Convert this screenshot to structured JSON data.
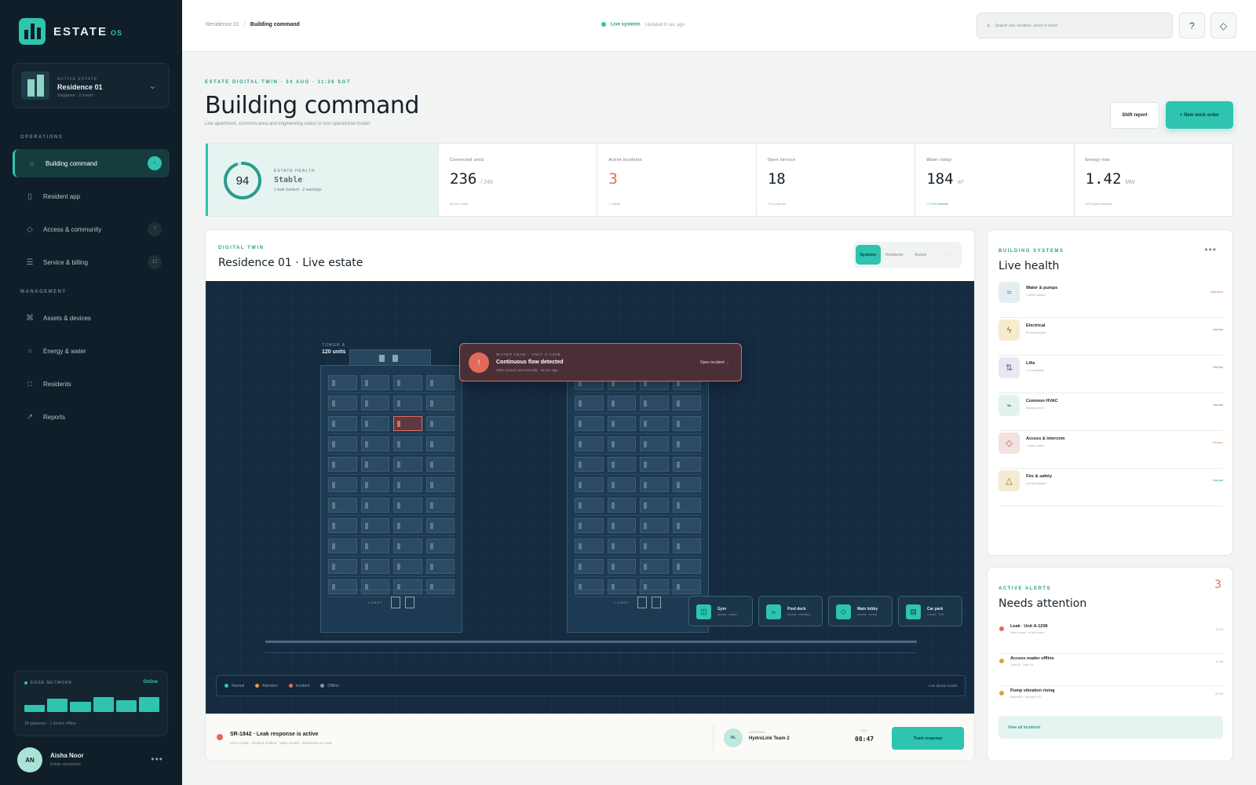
{
  "brand": {
    "name": "ESTATE",
    "suffix": "OS"
  },
  "estate": {
    "kicker": "ACTIVE ESTATE",
    "name": "Residence 01",
    "sub": "Singapore · 2 towers"
  },
  "nav": {
    "operations_heading": "OPERATIONS",
    "management_heading": "MANAGEMENT",
    "items": [
      {
        "label": "Building command",
        "icon": "home-icon",
        "badge": "›"
      },
      {
        "label": "Resident app",
        "icon": "phone-icon",
        "badge": ""
      },
      {
        "label": "Access & community",
        "icon": "diamond-icon",
        "badge": "7"
      },
      {
        "label": "Service & billing",
        "icon": "list-icon",
        "badge": "12"
      },
      {
        "label": "Assets & devices",
        "icon": "command-icon",
        "badge": ""
      },
      {
        "label": "Energy & water",
        "icon": "circle-icon",
        "badge": ""
      },
      {
        "label": "Residents",
        "icon": "square-icon",
        "badge": ""
      },
      {
        "label": "Reports",
        "icon": "trend-icon",
        "badge": ""
      }
    ]
  },
  "edge": {
    "title": "EDGE NETWORK",
    "status": "Online",
    "bars": [
      0.4,
      0.75,
      0.6,
      0.85,
      0.7,
      0.85
    ],
    "foot": "18 gateways · 1 device offline"
  },
  "user": {
    "initials": "AN",
    "name": "Aisha Noor",
    "role": "Estate operations"
  },
  "topbar": {
    "crumb_parent": "Residence 01",
    "crumb_current": "Building command",
    "live_label": "Live systems",
    "live_updated": "Updated 8 sec ago",
    "search_placeholder": "Search unit, resident, asset or ticket",
    "help_glyph": "?"
  },
  "header": {
    "kicker": "ESTATE DIGITAL TWIN · 24 AUG · 11:26 SGT",
    "title": "Building command",
    "subtitle": "Live apartment, common-area and engineering status in one operational model.",
    "shift_report": "Shift report",
    "new_work_order": "+ New work order"
  },
  "kpis": {
    "health": {
      "score": "94",
      "score_fraction": 0.94,
      "kicker": "ESTATE HEALTH",
      "state": "Stable",
      "sub": "1 leak incident · 2 warnings"
    },
    "items": [
      {
        "label": "Connected units",
        "value": "236",
        "unit": "/ 240",
        "foot": "98.3% online",
        "alert": false,
        "good": false
      },
      {
        "label": "Active incidents",
        "value": "3",
        "unit": "",
        "foot": "1 critical",
        "alert": true,
        "good": false
      },
      {
        "label": "Open service",
        "value": "18",
        "unit": "",
        "foot": "7 in progress",
        "alert": false,
        "good": false
      },
      {
        "label": "Water today",
        "value": "184",
        "unit": "m³",
        "foot": "↓ 4.2% baseline",
        "alert": false,
        "good": true
      },
      {
        "label": "Energy now",
        "value": "1.42",
        "unit": "MW",
        "foot": "62% peak capacity",
        "alert": false,
        "good": false
      }
    ]
  },
  "twin": {
    "kicker": "DIGITAL TWIN",
    "title": "Residence 01  · Live estate",
    "segments": [
      "Systems",
      "Residents",
      "Assets",
      "···"
    ],
    "tower_a": {
      "kicker": "TOWER A",
      "units": "120 units",
      "lobby": "LOBBY"
    },
    "tower_b": {
      "lobby": "LOBBY"
    },
    "alert": {
      "kicker": "WATER LEAK · UNIT A-1208",
      "title": "Continuous flow detected",
      "sub": "Valve closed automatically · 48 sec ago",
      "link": "Open incident →",
      "glyph": "!"
    },
    "amenities": [
      {
        "name": "Gym",
        "sub": "Normal · closed",
        "icon": "gym-icon",
        "glyph": "◫"
      },
      {
        "name": "Pool deck",
        "sub": "Normal · chemistry",
        "icon": "wave-icon",
        "glyph": "≈"
      },
      {
        "name": "Main lobby",
        "sub": "Access · normal",
        "icon": "diamond-icon",
        "glyph": "◇"
      },
      {
        "name": "Car park",
        "sub": "4 levels · 82%",
        "icon": "grid-icon",
        "glyph": "▤"
      }
    ],
    "legend": {
      "normal": "Normal",
      "attention": "Attention",
      "incident": "Incident",
      "offline": "Offline",
      "right": "Live device model"
    },
    "colors": {
      "normal": "#2ec4b0",
      "attention": "#e0a23b",
      "incident": "#e06b5b",
      "offline": "#8a96a0"
    },
    "response": {
      "title": "SR-1842 · Leak response is active",
      "sub": "Unit A-1208 · resident notified · valve closed · technician en route",
      "team_kicker": "ASSIGNED",
      "team_initials": "HL",
      "team_name": "HydroLink Team 2",
      "sla_kicker": "ETA",
      "sla_value": "08:47",
      "track": "Track response"
    }
  },
  "systems": {
    "kicker": "BUILDING SYSTEMS",
    "title": "Live health",
    "items": [
      {
        "name": "Water & pumps",
        "sub": "1 active incident",
        "status": "Attention",
        "glyph": "≈",
        "icon": "water-icon",
        "bg": "#e4eef1",
        "fg": "#3c7d8c",
        "status_color": "#e06b5b"
      },
      {
        "name": "Electrical",
        "sub": "All boards stable",
        "status": "Normal",
        "glyph": "ϟ",
        "icon": "bolt-icon",
        "bg": "#f6ebcd",
        "fg": "#8a6a1c",
        "status_color": "#2a9d8f"
      },
      {
        "name": "Lifts",
        "sub": "6 of 6 available",
        "status": "Normal",
        "glyph": "⇅",
        "icon": "lift-icon",
        "bg": "#ece6f2",
        "fg": "#6a5487",
        "status_color": "#2a9d8f"
      },
      {
        "name": "Common HVAC",
        "sub": "Efficiency 91%",
        "status": "Normal",
        "glyph": "⌁",
        "icon": "hvac-icon",
        "bg": "#e2f3ee",
        "fg": "#2a7d70",
        "status_color": "#2a9d8f"
      },
      {
        "name": "Access & intercom",
        "sub": "1 reader offline",
        "status": "Review",
        "glyph": "◇",
        "icon": "access-icon",
        "bg": "#f3e2df",
        "fg": "#b0574b",
        "status_color": "#d98a3a"
      },
      {
        "name": "Fire & safety",
        "sub": "Last test passed",
        "status": "Normal",
        "glyph": "△",
        "icon": "warning-icon",
        "bg": "#f5ead3",
        "fg": "#8a6a1c",
        "status_color": "#2a9d8f"
      }
    ]
  },
  "alerts": {
    "kicker": "ACTIVE ALERTS",
    "title": "Needs attention",
    "count": "3",
    "items": [
      {
        "title": "Leak · Unit A-1208",
        "sub": "Valve closed · on-site action",
        "time": "11:24",
        "color": "#e06b5b"
      },
      {
        "title": "Access reader offline",
        "sub": "Tower B · Level 19",
        "time": "10:58",
        "color": "#e0a23b"
      },
      {
        "title": "Pump vibration rising",
        "sub": "Basement · Booster P-02",
        "time": "09:16",
        "color": "#e0a23b"
      }
    ],
    "view_all": "View all incidents",
    "arrow": "→"
  }
}
